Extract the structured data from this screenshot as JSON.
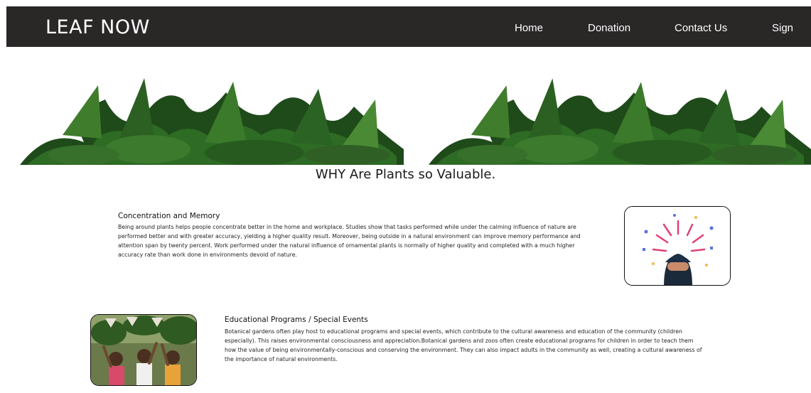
{
  "header": {
    "brand": "LEAF NOW",
    "nav": [
      "Home",
      "Donation",
      "Contact Us",
      "Sign"
    ]
  },
  "section": {
    "title": "WHY Are Plants so Valuable."
  },
  "cards": [
    {
      "title": "Concentration and Memory",
      "body": "Being around plants helps people concentrate better in the home and workplace. Studies show that tasks performed while under the calming influence of nature are performed better and with greater accuracy, yielding a higher quality result. Moreover, being outside in a natural environment can improve memory performance and attention span by twenty percent. Work performed under the natural influence of ornamental plants is normally of higher quality and completed with a much higher accuracy rate than work done in environments devoid of nature."
    },
    {
      "title": "Educational Programs / Special Events",
      "body": "Botanical gardens often play host to educational programs and special events, which contribute to the cultural awareness and education of the community (children especially). This raises environmental consciousness and appreciation.Botanical gardens and zoos often create educational programs for children in order to teach them how the value of being environmentally-conscious and conserving the environment. They can also impact adults in the community as well, creating a cultural awareness of the importance of natural environments."
    }
  ]
}
